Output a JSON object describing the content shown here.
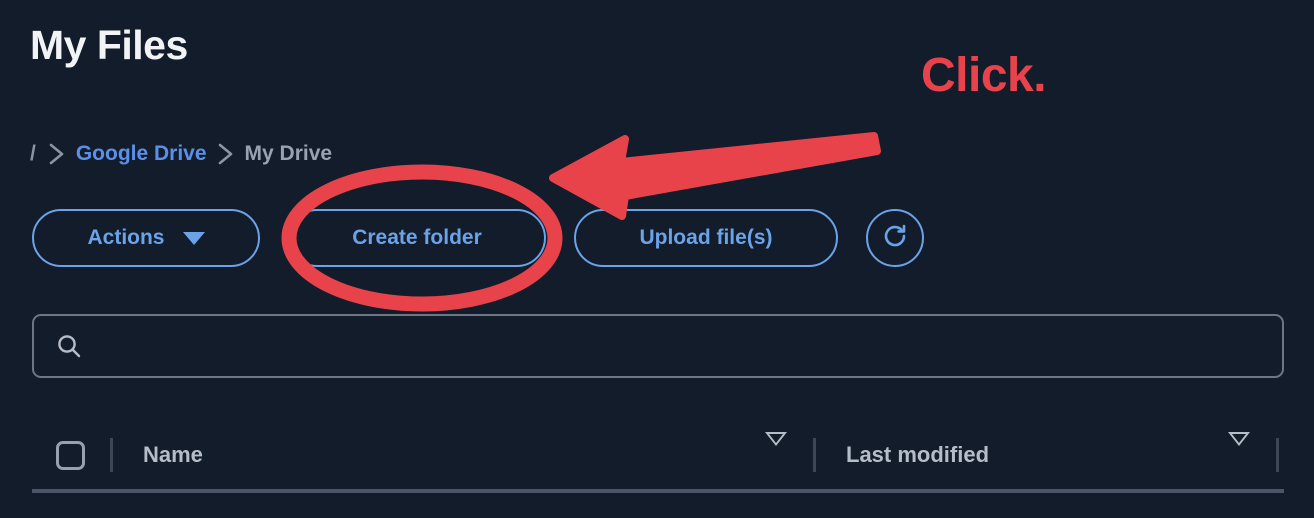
{
  "page": {
    "title": "My Files",
    "background_color": "#131c2b"
  },
  "breadcrumb": {
    "root": "/",
    "separator_icon": "chevron-right-icon",
    "items": [
      {
        "label": "Google Drive",
        "color": "#5b90e8",
        "active": false
      },
      {
        "label": "My Drive",
        "color": "#99a2b0",
        "active": true
      }
    ]
  },
  "toolbar": {
    "accent_color": "#6ba3e8",
    "actions_label": "Actions",
    "actions_caret_icon": "caret-down-icon",
    "create_folder_label": "Create folder",
    "upload_files_label": "Upload file(s)",
    "refresh_icon": "refresh-icon"
  },
  "search": {
    "icon": "search-icon",
    "value": "",
    "placeholder": ""
  },
  "table": {
    "select_all_checkbox": "select-all-checkbox",
    "columns": [
      {
        "label": "Name",
        "sort_icon": "sort-descending-icon"
      },
      {
        "label": "Last modified",
        "sort_icon": "sort-descending-icon"
      }
    ]
  },
  "annotations": {
    "highlight_color": "#e8434b",
    "click_text": "Click.",
    "arrow_icon": "arrow-left-icon",
    "ellipse_icon": "ellipse-highlight-icon",
    "target": "Create folder"
  }
}
